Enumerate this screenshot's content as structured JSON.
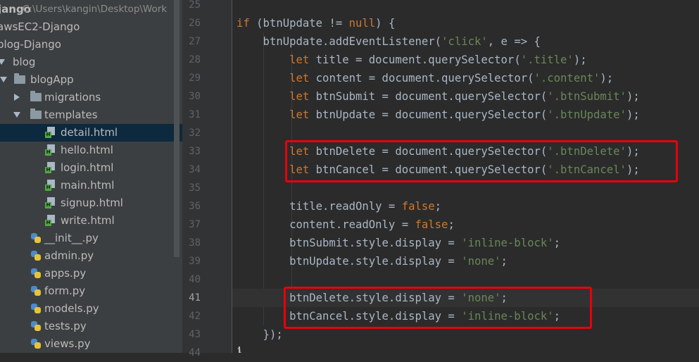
{
  "sidebar": {
    "items": [
      {
        "label": "jango",
        "path": "C:\\Users\\kangin\\Desktop\\Work",
        "kind": "project"
      },
      {
        "label": "awsEC2-Django",
        "kind": "plain"
      },
      {
        "label": "blog-Django",
        "kind": "plain"
      },
      {
        "label": "blog",
        "kind": "folder",
        "expanded": true
      },
      {
        "label": "blogApp",
        "kind": "folder",
        "expanded": true
      },
      {
        "label": "migrations",
        "kind": "folder",
        "expanded": false
      },
      {
        "label": "templates",
        "kind": "folder",
        "expanded": true
      },
      {
        "label": "detail.html",
        "kind": "html",
        "selected": true
      },
      {
        "label": "hello.html",
        "kind": "html"
      },
      {
        "label": "login.html",
        "kind": "html"
      },
      {
        "label": "main.html",
        "kind": "html"
      },
      {
        "label": "signup.html",
        "kind": "html"
      },
      {
        "label": "write.html",
        "kind": "html"
      },
      {
        "label": "__init__.py",
        "kind": "py"
      },
      {
        "label": "admin.py",
        "kind": "py"
      },
      {
        "label": "apps.py",
        "kind": "py"
      },
      {
        "label": "form.py",
        "kind": "py"
      },
      {
        "label": "models.py",
        "kind": "py"
      },
      {
        "label": "tests.py",
        "kind": "py"
      },
      {
        "label": "views.py",
        "kind": "py"
      }
    ]
  },
  "editor": {
    "current_line": 41,
    "lines": [
      {
        "num": "25",
        "code": ""
      },
      {
        "num": "26",
        "code": "if (btnUpdate != null) {"
      },
      {
        "num": "27",
        "code": "    btnUpdate.addEventListener('click', e => {"
      },
      {
        "num": "28",
        "code": "        let title = document.querySelector('.title');"
      },
      {
        "num": "29",
        "code": "        let content = document.querySelector('.content');"
      },
      {
        "num": "30",
        "code": "        let btnSubmit = document.querySelector('.btnSubmit');"
      },
      {
        "num": "31",
        "code": "        let btnUpdate = document.querySelector('.btnUpdate');"
      },
      {
        "num": "32",
        "code": ""
      },
      {
        "num": "33",
        "code": "        let btnDelete = document.querySelector('.btnDelete');"
      },
      {
        "num": "34",
        "code": "        let btnCancel = document.querySelector('.btnCancel');"
      },
      {
        "num": "35",
        "code": ""
      },
      {
        "num": "36",
        "code": "        title.readOnly = false;"
      },
      {
        "num": "37",
        "code": "        content.readOnly = false;"
      },
      {
        "num": "38",
        "code": "        btnSubmit.style.display = 'inline-block';"
      },
      {
        "num": "39",
        "code": "        btnUpdate.style.display = 'none';"
      },
      {
        "num": "40",
        "code": ""
      },
      {
        "num": "41",
        "code": "        btnDelete.style.display = 'none';"
      },
      {
        "num": "42",
        "code": "        btnCancel.style.display = 'inline-block';"
      },
      {
        "num": "43",
        "code": "    });"
      },
      {
        "num": "44",
        "code": "}"
      }
    ],
    "highlights": [
      {
        "from_line": 33,
        "to_line": 34,
        "color": "#e8000b"
      },
      {
        "from_line": 41,
        "to_line": 42,
        "color": "#e8000b"
      }
    ]
  },
  "colors": {
    "keyword": "#cc7832",
    "string": "#6a8759",
    "text": "#a9b7c6",
    "highlight_box": "#e8000b"
  }
}
